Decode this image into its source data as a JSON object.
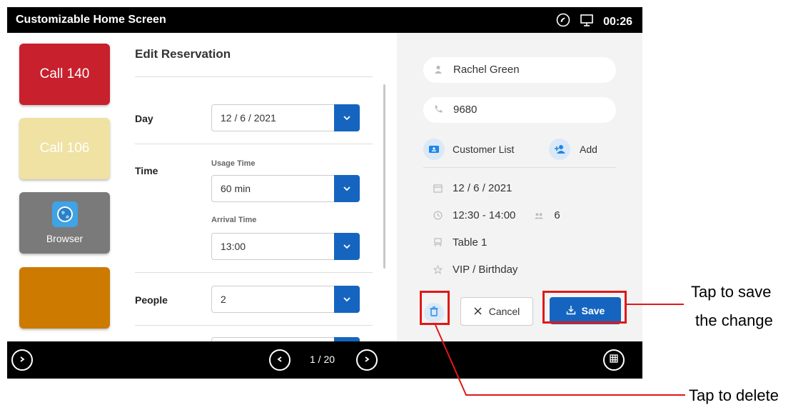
{
  "status_bar": {
    "title": "Customizable Home Screen",
    "time": "00:26",
    "icons": [
      "phone-call-icon",
      "desktop-icon"
    ]
  },
  "tiles": [
    {
      "label": "Call 140",
      "color": "#c8202d"
    },
    {
      "label": "Call 106",
      "color": "#efe2a3"
    },
    {
      "label": "Browser",
      "color": "#7a7a7a",
      "icon": "globe-icon"
    },
    {
      "label": "",
      "color": "#cc7a00"
    }
  ],
  "form": {
    "heading": "Edit Reservation",
    "day": {
      "label": "Day",
      "value": "12 / 6 / 2021"
    },
    "time": {
      "label": "Time",
      "usage_label": "Usage Time",
      "usage_value": "60 min",
      "arrival_label": "Arrival Time",
      "arrival_value": "13:00"
    },
    "people": {
      "label": "People",
      "value": "2"
    }
  },
  "detail": {
    "name": "Rachel Green",
    "phone": "9680",
    "customer_list": "Customer List",
    "add": "Add",
    "date": "12 / 6 / 2021",
    "time_range": "12:30 - 14:00",
    "guests": "6",
    "table": "Table 1",
    "note": "VIP / Birthday",
    "cancel": "Cancel",
    "save": "Save"
  },
  "nav": {
    "page": "1 / 20"
  },
  "annotations": {
    "save_line1": "Tap to save",
    "save_line2": "the change",
    "delete": "Tap to delete"
  },
  "colors": {
    "accent": "#1565c0",
    "highlight": "#e01818"
  }
}
